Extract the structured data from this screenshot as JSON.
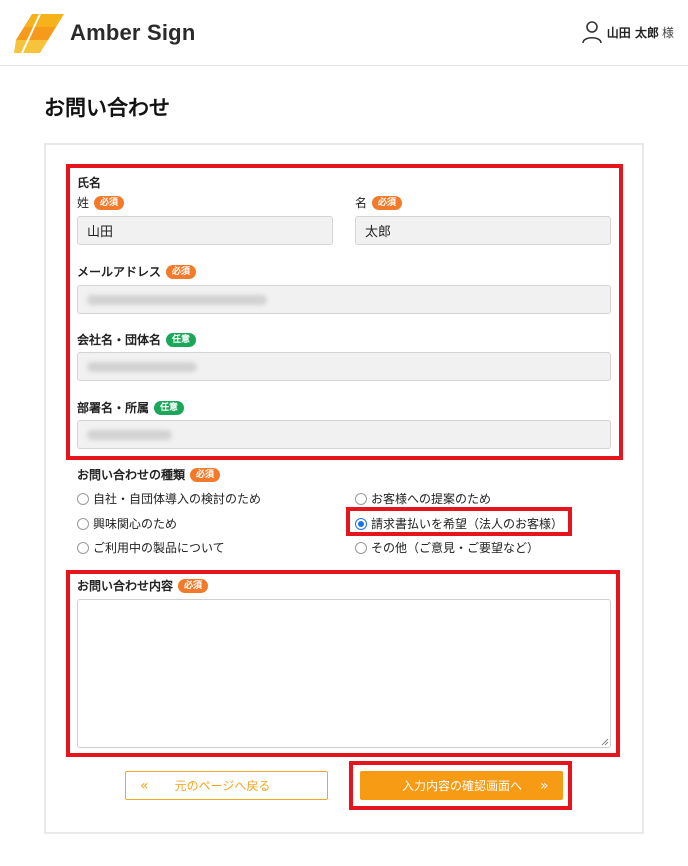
{
  "header": {
    "brand": "Amber Sign",
    "user_name": "山田 太郎",
    "user_honorific": "様"
  },
  "page": {
    "title": "お問い合わせ"
  },
  "form": {
    "name_section_label": "氏名",
    "last_name": {
      "label": "姓",
      "badge": "必須",
      "value": "山田"
    },
    "first_name": {
      "label": "名",
      "badge": "必須",
      "value": "太郎"
    },
    "email": {
      "label": "メールアドレス",
      "badge": "必須"
    },
    "company": {
      "label": "会社名・団体名",
      "badge": "任意"
    },
    "department": {
      "label": "部署名・所属",
      "badge": "任意"
    },
    "inquiry_type": {
      "label": "お問い合わせの種類",
      "badge": "必須",
      "options": [
        "自社・自団体導入の検討のため",
        "お客様への提案のため",
        "興味関心のため",
        "請求書払いを希望（法人のお客様）",
        "ご利用中の製品について",
        "その他（ご意見・ご要望など）"
      ],
      "selected": "請求書払いを希望（法人のお客様）"
    },
    "content": {
      "label": "お問い合わせ内容",
      "badge": "必須",
      "value": ""
    }
  },
  "buttons": {
    "back_label": "元のページへ戻る",
    "back_chevron": "«",
    "confirm_label": "入力内容の確認画面へ",
    "confirm_chevron": "»"
  },
  "colors": {
    "accent": "#f79a14",
    "required_badge": "#f37a2a",
    "optional_badge": "#1aa75a",
    "highlight": "#e5141d",
    "radio_checked": "#1a73e8"
  },
  "icons": {
    "logo": "amber-sign-logo-icon",
    "user": "user-icon",
    "radio": "radio-icon",
    "resize": "resize-handle-icon"
  }
}
